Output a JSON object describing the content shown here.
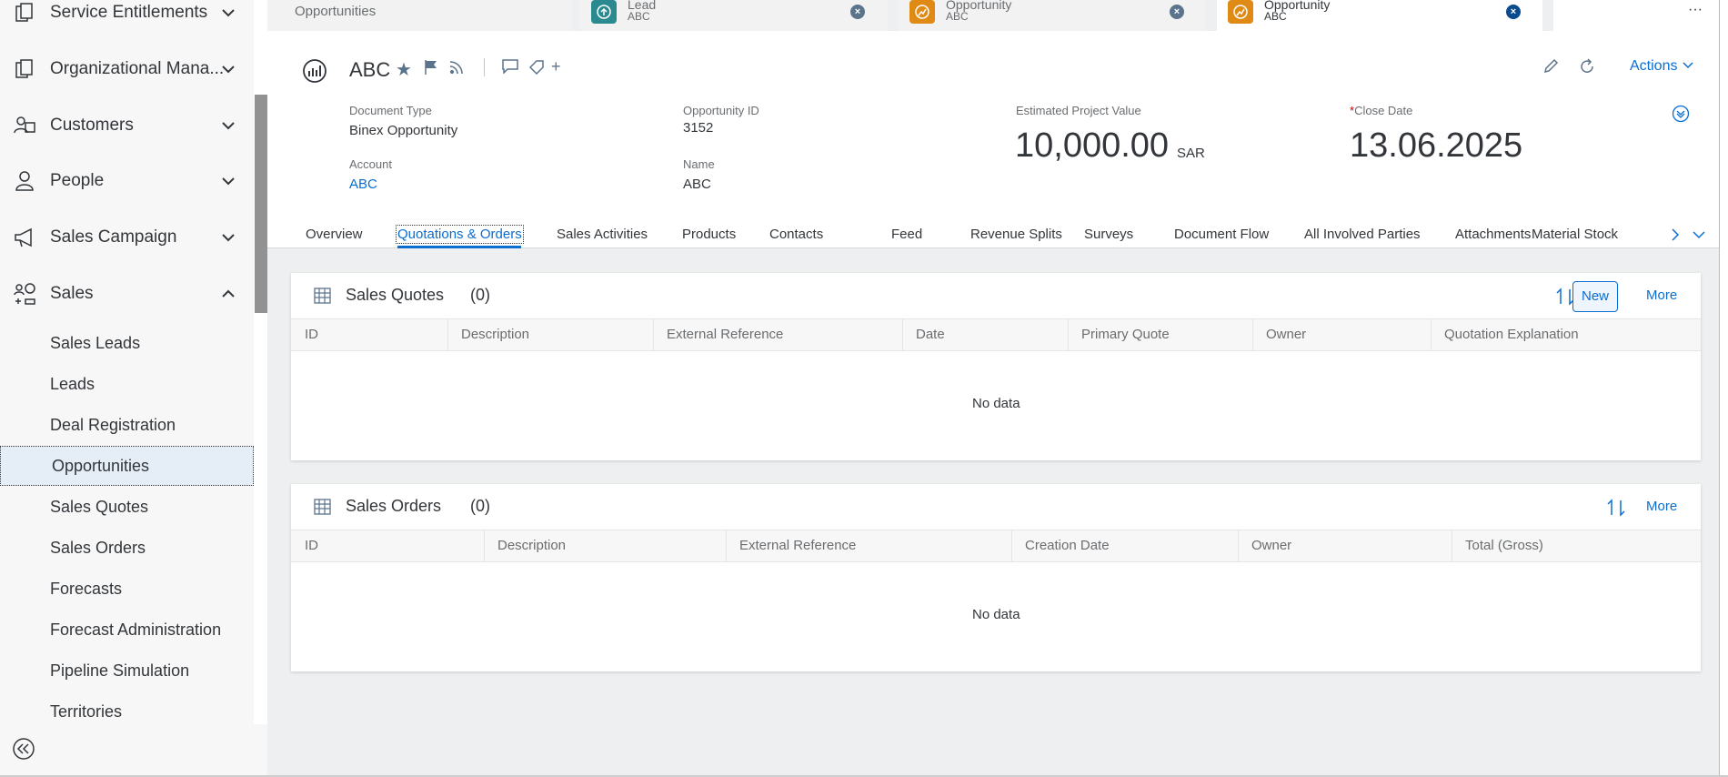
{
  "sidebar": {
    "groups": [
      {
        "label": "Service Entitlements",
        "icon": "service-entitlements-icon",
        "expanded": false
      },
      {
        "label": "Organizational Mana...",
        "icon": "organizational-management-icon",
        "expanded": false
      },
      {
        "label": "Customers",
        "icon": "customers-icon",
        "expanded": false
      },
      {
        "label": "People",
        "icon": "person-icon",
        "expanded": false
      },
      {
        "label": "Sales Campaign",
        "icon": "megaphone-icon",
        "expanded": false
      },
      {
        "label": "Sales",
        "icon": "sales-icon",
        "expanded": true
      }
    ],
    "sales_items": [
      "Sales Leads",
      "Leads",
      "Deal Registration",
      "Opportunities",
      "Sales Quotes",
      "Sales Orders",
      "Forecasts",
      "Forecast Administration",
      "Pipeline Simulation",
      "Territories"
    ],
    "selected_item": "Opportunities",
    "collapse_icon": "double-chevron-left-icon"
  },
  "window_tabs": [
    {
      "title": "Opportunities",
      "subtitle": "",
      "icon": "",
      "active": false
    },
    {
      "title": "Lead",
      "subtitle": "ABC",
      "icon": "lead-icon",
      "color": "#2a8a8f",
      "active": false
    },
    {
      "title": "Opportunity",
      "subtitle": "ABC",
      "icon": "opportunity-icon",
      "color": "#e08a16",
      "active": false
    },
    {
      "title": "Opportunity",
      "subtitle": "ABC",
      "icon": "opportunity-icon",
      "color": "#e08a16",
      "active": true
    }
  ],
  "overflow_label": "···",
  "header": {
    "title": "ABC",
    "plus_label": "+",
    "actions_label": "Actions",
    "fields": {
      "document_type": {
        "label": "Document Type",
        "value": "Binex Opportunity"
      },
      "account": {
        "label": "Account",
        "value": "ABC"
      },
      "opportunity_id": {
        "label": "Opportunity ID",
        "value": "3152"
      },
      "name": {
        "label": "Name",
        "value": "ABC"
      },
      "estimated_value": {
        "label": "Estimated Project Value",
        "value": "10,000.00",
        "unit": "SAR"
      },
      "close_date": {
        "label": "Close Date",
        "required_mark": "*",
        "value": "13.06.2025"
      }
    }
  },
  "section_tabs": [
    "Overview",
    "Quotations & Orders",
    "Sales Activities",
    "Products",
    "Contacts",
    "Feed",
    "Revenue Splits",
    "Surveys",
    "Document Flow",
    "All Involved Parties",
    "Attachments",
    "Material Stock"
  ],
  "selected_section": "Quotations & Orders",
  "sales_quotes": {
    "title": "Sales Quotes",
    "count": "(0)",
    "new_label": "New",
    "more_label": "More",
    "columns": [
      "ID",
      "Description",
      "External Reference",
      "Date",
      "Primary Quote",
      "Owner",
      "Quotation Explanation"
    ],
    "empty_text": "No data"
  },
  "sales_orders": {
    "title": "Sales Orders",
    "count": "(0)",
    "more_label": "More",
    "columns": [
      "ID",
      "Description",
      "External Reference",
      "Creation Date",
      "Owner",
      "Total (Gross)"
    ],
    "empty_text": "No data"
  },
  "colors": {
    "accent": "#0a6ed1",
    "lead": "#2a8a8f",
    "opportunity": "#e08a16",
    "selected_nav": "#e5edf6"
  }
}
